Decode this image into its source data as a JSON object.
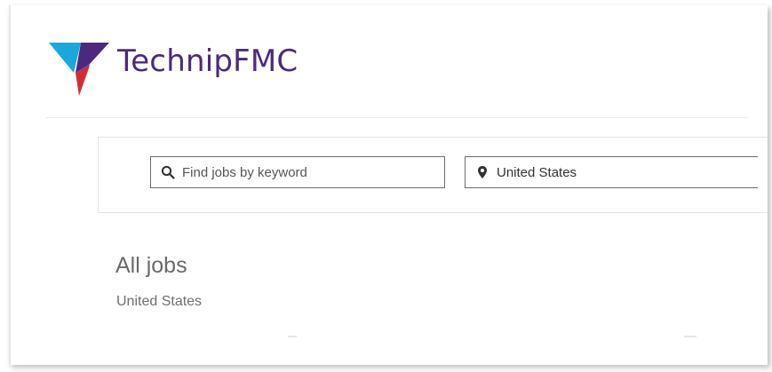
{
  "header": {
    "brand_name": "TechnipFMC",
    "brand_colors": {
      "cyan": "#1aa7dc",
      "purple": "#4b2a7e",
      "red": "#d22c3a"
    }
  },
  "search": {
    "keyword_placeholder": "Find jobs by keyword",
    "keyword_value": "",
    "location_value": "United States",
    "keyword_icon": "search-icon",
    "location_icon": "map-pin-icon"
  },
  "results": {
    "title": "All jobs",
    "subtitle": "United States"
  }
}
